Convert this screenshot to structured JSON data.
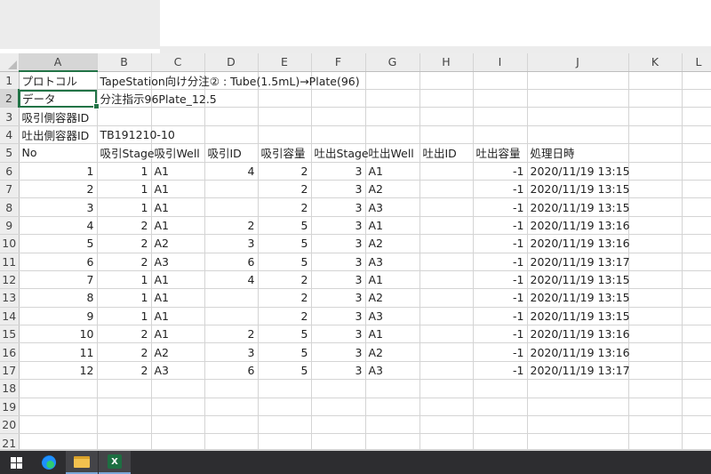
{
  "columns": [
    "A",
    "B",
    "C",
    "D",
    "E",
    "F",
    "G",
    "H",
    "I",
    "J",
    "K",
    "L"
  ],
  "rows": [
    {
      "n": "1",
      "cells": [
        "プロトコル",
        "TapeStation向け分注② : Tube(1.5mL)→Plate(96)",
        "",
        "",
        "",
        "",
        "",
        "",
        "",
        "",
        "",
        ""
      ]
    },
    {
      "n": "2",
      "cells": [
        "データ",
        "分注指示96Plate_12.5",
        "",
        "",
        "",
        "",
        "",
        "",
        "",
        "",
        "",
        ""
      ]
    },
    {
      "n": "3",
      "cells": [
        "吸引側容器ID",
        "",
        "",
        "",
        "",
        "",
        "",
        "",
        "",
        "",
        "",
        ""
      ]
    },
    {
      "n": "4",
      "cells": [
        "吐出側容器ID",
        "TB191210-10",
        "",
        "",
        "",
        "",
        "",
        "",
        "",
        "",
        "",
        ""
      ]
    },
    {
      "n": "5",
      "cells": [
        "No",
        "吸引Stage",
        "吸引Well",
        "吸引ID",
        "吸引容量",
        "吐出Stage",
        "吐出Well",
        "吐出ID",
        "吐出容量",
        "処理日時",
        "",
        ""
      ]
    },
    {
      "n": "6",
      "cells": [
        "1",
        "1",
        "A1",
        "4",
        "2",
        "3",
        "A1",
        "",
        "-1",
        "2020/11/19 13:15",
        "",
        ""
      ]
    },
    {
      "n": "7",
      "cells": [
        "2",
        "1",
        "A1",
        "",
        "2",
        "3",
        "A2",
        "",
        "-1",
        "2020/11/19 13:15",
        "",
        ""
      ]
    },
    {
      "n": "8",
      "cells": [
        "3",
        "1",
        "A1",
        "",
        "2",
        "3",
        "A3",
        "",
        "-1",
        "2020/11/19 13:15",
        "",
        ""
      ]
    },
    {
      "n": "9",
      "cells": [
        "4",
        "2",
        "A1",
        "2",
        "5",
        "3",
        "A1",
        "",
        "-1",
        "2020/11/19 13:16",
        "",
        ""
      ]
    },
    {
      "n": "10",
      "cells": [
        "5",
        "2",
        "A2",
        "3",
        "5",
        "3",
        "A2",
        "",
        "-1",
        "2020/11/19 13:16",
        "",
        ""
      ]
    },
    {
      "n": "11",
      "cells": [
        "6",
        "2",
        "A3",
        "6",
        "5",
        "3",
        "A3",
        "",
        "-1",
        "2020/11/19 13:17",
        "",
        ""
      ]
    },
    {
      "n": "12",
      "cells": [
        "7",
        "1",
        "A1",
        "4",
        "2",
        "3",
        "A1",
        "",
        "-1",
        "2020/11/19 13:15",
        "",
        ""
      ]
    },
    {
      "n": "13",
      "cells": [
        "8",
        "1",
        "A1",
        "",
        "2",
        "3",
        "A2",
        "",
        "-1",
        "2020/11/19 13:15",
        "",
        ""
      ]
    },
    {
      "n": "14",
      "cells": [
        "9",
        "1",
        "A1",
        "",
        "2",
        "3",
        "A3",
        "",
        "-1",
        "2020/11/19 13:15",
        "",
        ""
      ]
    },
    {
      "n": "15",
      "cells": [
        "10",
        "2",
        "A1",
        "2",
        "5",
        "3",
        "A1",
        "",
        "-1",
        "2020/11/19 13:16",
        "",
        ""
      ]
    },
    {
      "n": "16",
      "cells": [
        "11",
        "2",
        "A2",
        "3",
        "5",
        "3",
        "A2",
        "",
        "-1",
        "2020/11/19 13:16",
        "",
        ""
      ]
    },
    {
      "n": "17",
      "cells": [
        "12",
        "2",
        "A3",
        "6",
        "5",
        "3",
        "A3",
        "",
        "-1",
        "2020/11/19 13:17",
        "",
        ""
      ]
    },
    {
      "n": "18",
      "cells": [
        "",
        "",
        "",
        "",
        "",
        "",
        "",
        "",
        "",
        "",
        "",
        ""
      ]
    },
    {
      "n": "19",
      "cells": [
        "",
        "",
        "",
        "",
        "",
        "",
        "",
        "",
        "",
        "",
        "",
        ""
      ]
    },
    {
      "n": "20",
      "cells": [
        "",
        "",
        "",
        "",
        "",
        "",
        "",
        "",
        "",
        "",
        "",
        ""
      ]
    },
    {
      "n": "21",
      "cells": [
        "",
        "",
        "",
        "",
        "",
        "",
        "",
        "",
        "",
        "",
        "",
        ""
      ]
    }
  ],
  "selected_cell": "A2",
  "taskbar": {
    "start_icon": "windows-start-icon",
    "items": [
      "edge-browser-icon",
      "file-explorer-icon",
      "excel-icon"
    ],
    "excel_letter": "X"
  },
  "colors": {
    "excel_green": "#217346"
  }
}
